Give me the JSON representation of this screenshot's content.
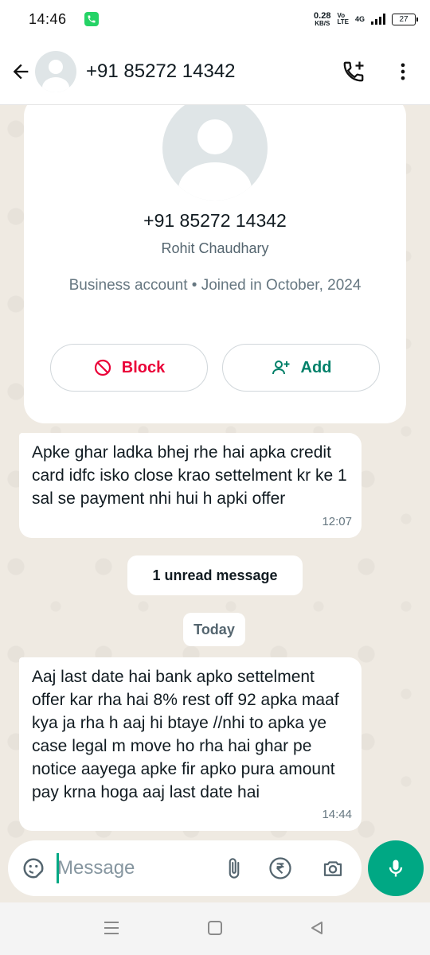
{
  "status_bar": {
    "time": "14:46",
    "net_speed_value": "0.28",
    "net_speed_unit": "KB/S",
    "volte_line1": "Vo",
    "volte_line2": "LTE",
    "network": "4G",
    "battery": "27"
  },
  "header": {
    "contact": "+91 85272 14342",
    "back_icon": "arrow-left-icon",
    "call_icon": "add-call-icon",
    "menu_icon": "more-vert-icon"
  },
  "profile": {
    "phone": "+91 85272 14342",
    "name": "Rohit Chaudhary",
    "info": "Business account • Joined in October, 2024",
    "block_label": "Block",
    "add_label": "Add"
  },
  "messages": [
    {
      "text": "Apke ghar ladka bhej rhe hai apka credit card idfc isko close krao settelment kr ke 1 sal se payment nhi hui h apki offer",
      "time": "12:07"
    },
    {
      "text": "Aaj last date hai bank apko settelment offer kar rha hai 8% rest off 92 apka maaf kya ja rha h aaj hi btaye //nhi to apka ye case legal m move ho rha hai ghar pe notice aayega apke fir apko pura amount pay krna hoga aaj last date hai",
      "time": "14:44"
    }
  ],
  "unread_label": "1 unread message",
  "date_label": "Today",
  "composer": {
    "placeholder": "Message"
  },
  "colors": {
    "accent": "#00a884",
    "danger": "#ea0038",
    "chat_bg": "#efeae2"
  }
}
